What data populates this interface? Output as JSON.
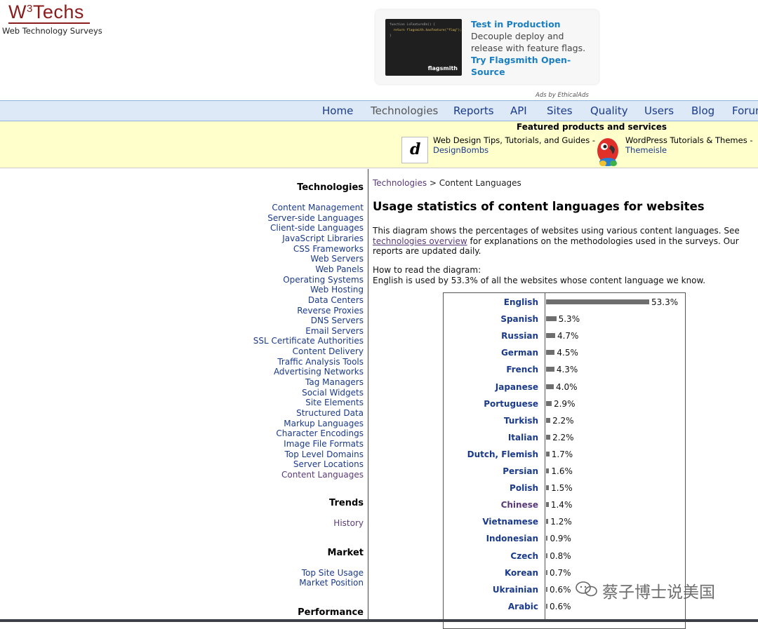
{
  "header": {
    "logo_main": "W",
    "logo_sup": "3",
    "logo_rest": "Techs",
    "tagline": "Web Technology Surveys",
    "ad": {
      "code_line1": "function isFeatureOn() {",
      "code_line2": "  return flagsmith.hasFeature(\"flag\");",
      "code_line3": "}",
      "brand": "flagsmith",
      "title": "Test in Production",
      "body": " Decouple deploy and release with feature flags. ",
      "cta": "Try Flagsmith Open-Source"
    },
    "ad_note": "Ads by EthicalAds"
  },
  "nav": {
    "items": [
      {
        "label": "Home"
      },
      {
        "label": "Technologies"
      },
      {
        "label": "Reports"
      },
      {
        "label": "API"
      },
      {
        "label": "Sites"
      },
      {
        "label": "Quality"
      },
      {
        "label": "Users"
      },
      {
        "label": "Blog"
      },
      {
        "label": "Forums"
      }
    ]
  },
  "featured": {
    "title": "Featured products and services",
    "items": [
      {
        "text": "Web Design Tips, Tutorials, and Guides -",
        "link": "DesignBombs"
      },
      {
        "text": "WordPress Tutorials & Themes -",
        "link": "Themeisle"
      }
    ]
  },
  "sidebar": {
    "technologies_title": "Technologies",
    "technologies": [
      "Content Management",
      "Server-side Languages",
      "Client-side Languages",
      "JavaScript Libraries",
      "CSS Frameworks",
      "Web Servers",
      "Web Panels",
      "Operating Systems",
      "Web Hosting",
      "Data Centers",
      "Reverse Proxies",
      "DNS Servers",
      "Email Servers",
      "SSL Certificate Authorities",
      "Content Delivery",
      "Traffic Analysis Tools",
      "Advertising Networks",
      "Tag Managers",
      "Social Widgets",
      "Site Elements",
      "Structured Data",
      "Markup Languages",
      "Character Encodings",
      "Image File Formats",
      "Top Level Domains",
      "Server Locations",
      "Content Languages"
    ],
    "trends_title": "Trends",
    "trends": [
      "History"
    ],
    "market_title": "Market",
    "market": [
      "Top Site Usage",
      "Market Position"
    ],
    "performance_title": "Performance"
  },
  "main": {
    "breadcrumb_link": "Technologies",
    "breadcrumb_sep": " > ",
    "breadcrumb_current": "Content Languages",
    "title": "Usage statistics of content languages for websites",
    "para_before": "This diagram shows the percentages of websites using various content languages. See ",
    "para_link": "technologies overview",
    "para_after": " for explanations on the methodologies used in the surveys. Our reports are updated daily.",
    "howto_line1": "How to read the diagram:",
    "howto_line2": "English is used by 53.3% of all the websites whose content language we know."
  },
  "chart_data": {
    "type": "bar",
    "orientation": "horizontal",
    "unit": "%",
    "categories": [
      "English",
      "Spanish",
      "Russian",
      "German",
      "French",
      "Japanese",
      "Portuguese",
      "Turkish",
      "Italian",
      "Dutch, Flemish",
      "Persian",
      "Polish",
      "Chinese",
      "Vietnamese",
      "Indonesian",
      "Czech",
      "Korean",
      "Ukrainian",
      "Arabic"
    ],
    "values": [
      53.3,
      5.3,
      4.7,
      4.5,
      4.3,
      4.0,
      2.9,
      2.2,
      2.2,
      1.7,
      1.6,
      1.5,
      1.4,
      1.2,
      0.9,
      0.8,
      0.7,
      0.6,
      0.6
    ],
    "labels": [
      "53.3%",
      "5.3%",
      "4.7%",
      "4.5%",
      "4.3%",
      "4.0%",
      "2.9%",
      "2.2%",
      "2.2%",
      "1.7%",
      "1.6%",
      "1.5%",
      "1.4%",
      "1.2%",
      "0.9%",
      "0.8%",
      "0.7%",
      "0.6%",
      "0.6%"
    ],
    "bar_color": "#6e6e6e",
    "visited_category": "Chinese"
  },
  "watermark": "蔡子博士说美国",
  "colors": {
    "link": "#1a3a8a",
    "visited": "#5a3a7a",
    "nav_bg": "#dde9f7",
    "featured_bg": "#ffffcc",
    "logo": "#8a1c1c"
  }
}
